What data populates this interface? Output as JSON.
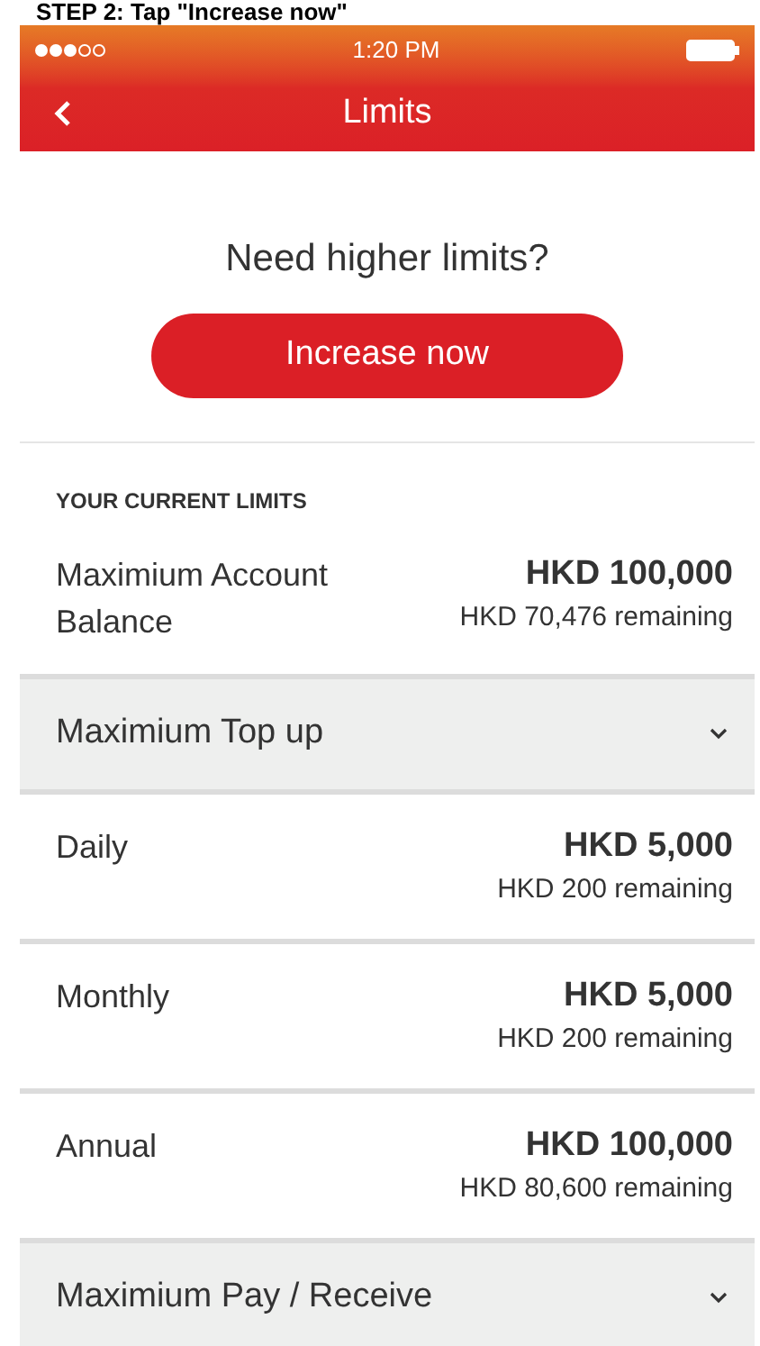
{
  "caption": "STEP 2: Tap \"Increase now\"",
  "status_bar": {
    "time": "1:20 PM"
  },
  "nav": {
    "title": "Limits"
  },
  "prompt": "Need higher limits?",
  "cta": "Increase now",
  "section_label": "YOUR CURRENT LIMITS",
  "balance": {
    "label": "Maximium Account Balance",
    "amount": "HKD 100,000",
    "remaining": "HKD 70,476 remaining"
  },
  "groups": [
    {
      "title": "Maximium Top up",
      "rows": [
        {
          "label": "Daily",
          "amount": "HKD 5,000",
          "remaining": "HKD 200 remaining"
        },
        {
          "label": "Monthly",
          "amount": "HKD 5,000",
          "remaining": "HKD 200 remaining"
        },
        {
          "label": "Annual",
          "amount": "HKD 100,000",
          "remaining": "HKD 80,600 remaining"
        }
      ]
    },
    {
      "title": "Maximium Pay / Receive"
    }
  ]
}
